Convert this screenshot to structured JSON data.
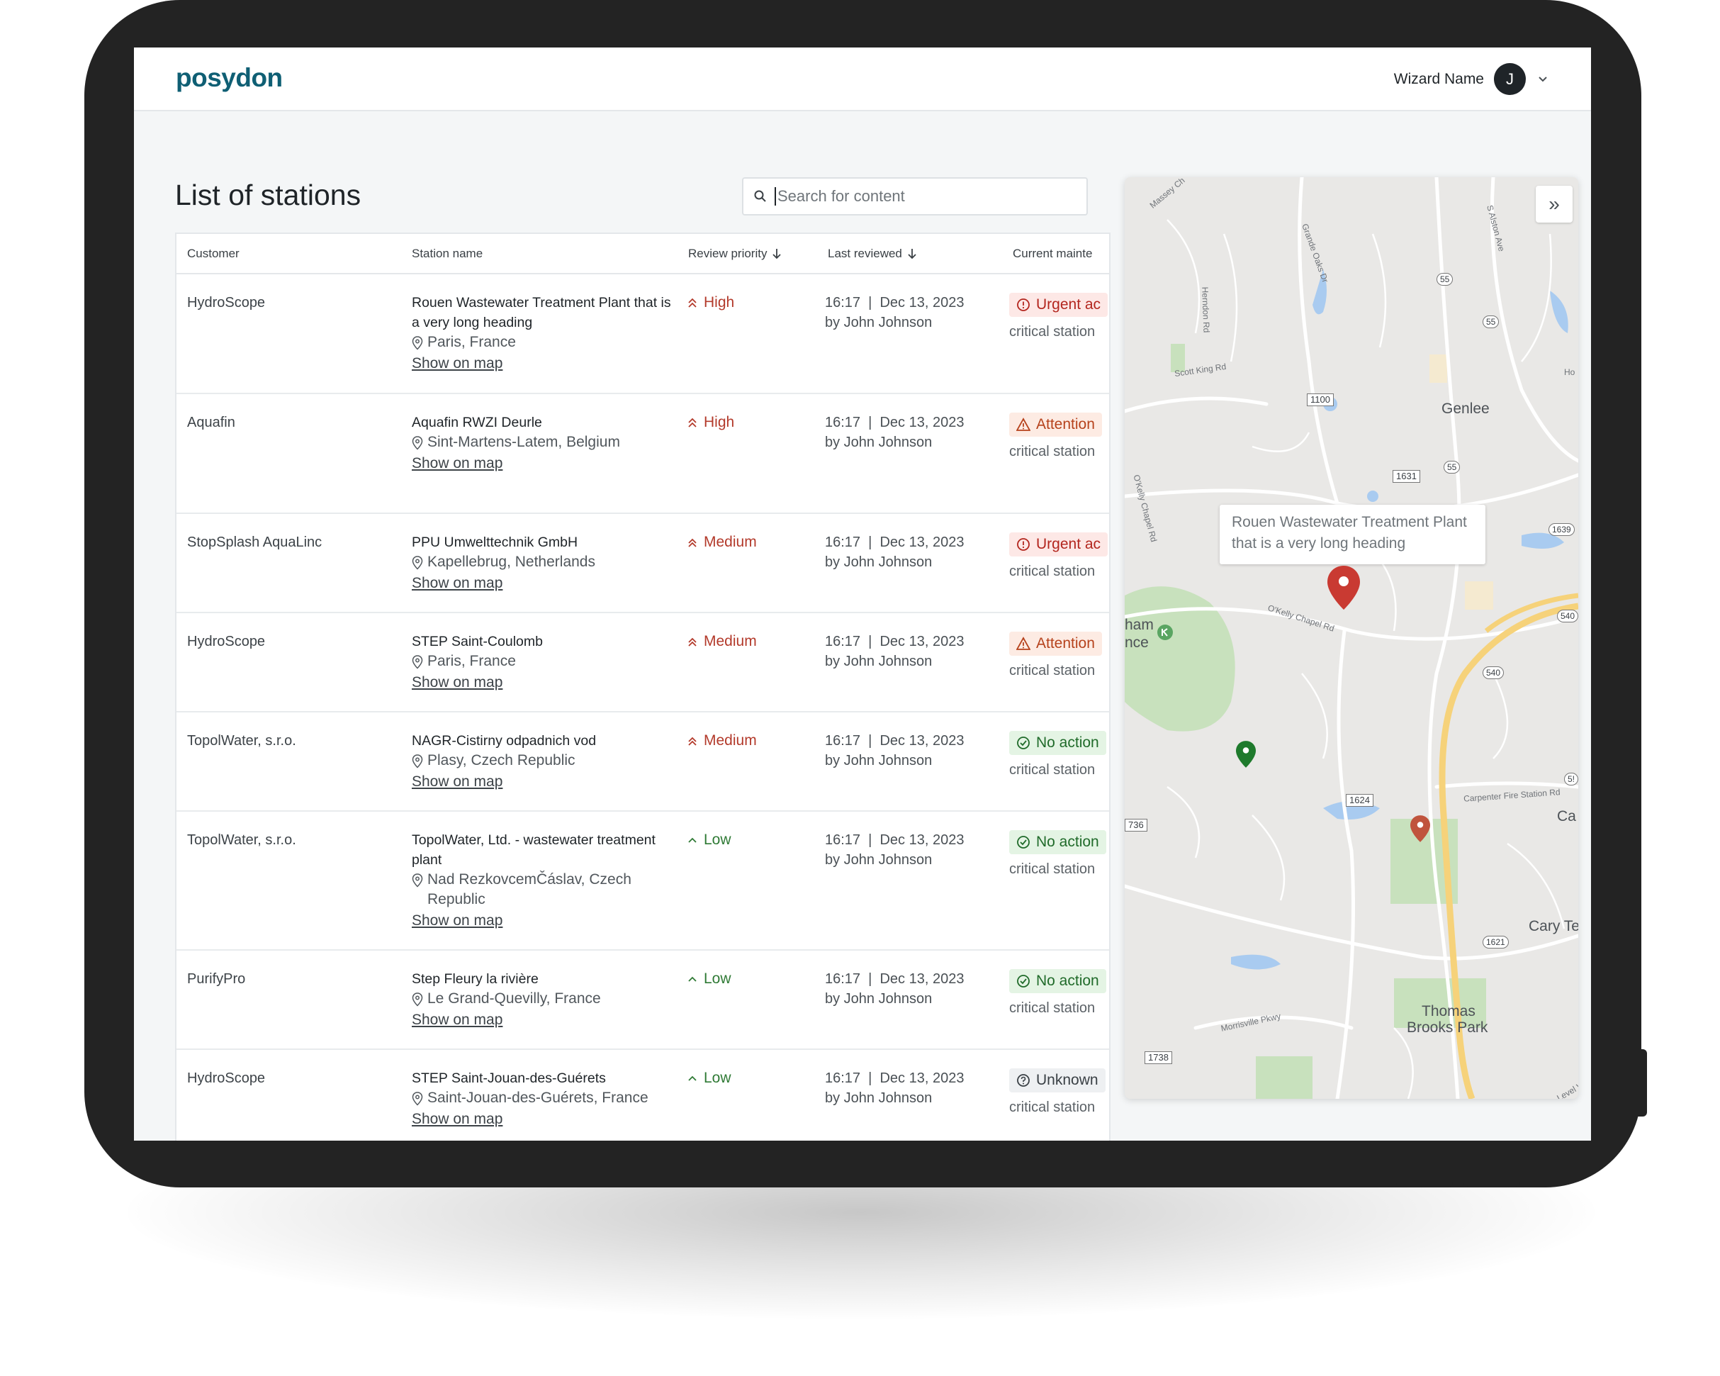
{
  "app": {
    "logo": "posydon"
  },
  "user": {
    "name": "Wizard Name",
    "initial": "J"
  },
  "page": {
    "title": "List of stations"
  },
  "search": {
    "placeholder": "Search for content"
  },
  "table": {
    "headers": {
      "customer": "Customer",
      "station": "Station name",
      "priority": "Review priority",
      "reviewed": "Last reviewed",
      "maintenance": "Current mainte"
    },
    "rows": [
      {
        "customer": "HydroScope",
        "name": "Rouen Wastewater Treatment Plant that is a very long heading",
        "location": "Paris, France",
        "link": "Show on map",
        "priority": "High",
        "priority_level": "high",
        "time": "16:17  |  Dec 13, 2023",
        "by": "by John Johnson",
        "status": "Urgent ac",
        "status_type": "urgent",
        "status_sub": "critical station"
      },
      {
        "customer": "Aquafin",
        "name": "Aquafin RWZI Deurle",
        "location": "Sint-Martens-Latem, Belgium",
        "link": "Show on map",
        "priority": "High",
        "priority_level": "high",
        "time": "16:17  |  Dec 13, 2023",
        "by": "by John Johnson",
        "status": "Attention",
        "status_type": "attention",
        "status_sub": "critical station"
      },
      {
        "customer": "StopSplash AquaLinc",
        "name": "PPU Umwelttechnik GmbH",
        "location": "Kapellebrug, Netherlands",
        "link": "Show on map",
        "priority": "Medium",
        "priority_level": "medium",
        "time": "16:17  |  Dec 13, 2023",
        "by": "by John Johnson",
        "status": "Urgent ac",
        "status_type": "urgent",
        "status_sub": "critical station"
      },
      {
        "customer": "HydroScope",
        "name": "STEP Saint-Coulomb",
        "location": "Paris, France",
        "link": "Show on map",
        "priority": "Medium",
        "priority_level": "medium",
        "time": "16:17  |  Dec 13, 2023",
        "by": "by John Johnson",
        "status": "Attention",
        "status_type": "attention",
        "status_sub": "critical station"
      },
      {
        "customer": "TopolWater, s.r.o.",
        "name": "NAGR-Cistirny odpadnich vod",
        "location": "Plasy, Czech Republic",
        "link": "Show on map",
        "priority": "Medium",
        "priority_level": "medium",
        "time": "16:17  |  Dec 13, 2023",
        "by": "by John Johnson",
        "status": "No action",
        "status_type": "noaction",
        "status_sub": "critical station"
      },
      {
        "customer": "TopolWater, s.r.o.",
        "name": "TopolWater, Ltd. - wastewater treatment plant",
        "location": "Nad RezkovcemČáslav, Czech Republic",
        "link": "Show on map",
        "priority": "Low",
        "priority_level": "low",
        "time": "16:17  |  Dec 13, 2023",
        "by": "by John Johnson",
        "status": "No action",
        "status_type": "noaction",
        "status_sub": "critical station"
      },
      {
        "customer": "PurifyPro",
        "name": "Step Fleury la rivière",
        "location": "Le Grand-Quevilly, France",
        "link": "Show on map",
        "priority": "Low",
        "priority_level": "low",
        "time": "16:17  |  Dec 13, 2023",
        "by": "by John Johnson",
        "status": "No action",
        "status_type": "noaction",
        "status_sub": "critical station"
      },
      {
        "customer": "HydroScope",
        "name": "STEP Saint-Jouan-des-Guérets",
        "location": "Saint-Jouan-des-Guérets, France",
        "link": "Show on map",
        "priority": "Low",
        "priority_level": "low",
        "time": "16:17  |  Dec 13, 2023",
        "by": "by John Johnson",
        "status": "Unknown",
        "status_type": "unknown",
        "status_sub": "critical station"
      }
    ]
  },
  "map": {
    "tooltip": "Rouen Wastewater Treatment Plant that is a very long heading",
    "collapse_icon": "»",
    "places": {
      "genlee": "Genlee",
      "thomas": "Thomas",
      "brooks": "Brooks Park",
      "cary": "Cary Te",
      "ca": "Ca",
      "ham": "ham",
      "nce": "nce"
    },
    "roads": {
      "scott_king": "Scott King Rd",
      "okelly_chapel": "O'Kelly Chapel Rd",
      "okelly_chapel2": "O'Kelly Chapel Rd",
      "morrisville": "Morrisville Pkwy",
      "carpenter": "Carpenter Fire Station Rd",
      "herndon": "Herndon Rd",
      "alston": "S Alston Ave",
      "massey": "Massey Ch",
      "grande": "Grande Oaks Dr",
      "ho": "Ho",
      "level": "Level W"
    },
    "shields": [
      "55",
      "55",
      "55",
      "1100",
      "1631",
      "1639",
      "540",
      "540",
      "1624",
      "1621",
      "1738",
      "736",
      "5!"
    ],
    "pin_colors": {
      "selected": "#c93a32",
      "green": "#1e7a2c",
      "orange": "#c0543d"
    }
  }
}
